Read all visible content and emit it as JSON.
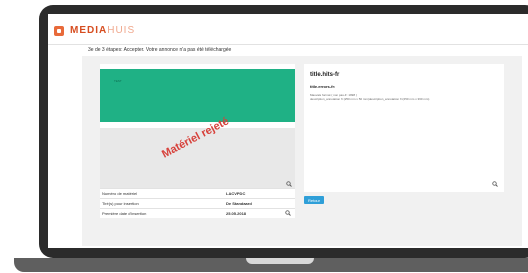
{
  "header": {
    "logo_bold": "MEDIA",
    "logo_light": "HUIS"
  },
  "step_text": "3e de 3 étapes: Accepter. Votre annonce n'a pas été téléchargée",
  "preview": {
    "green_label": "TEST",
    "stamp": "Matériel rejeté",
    "accent_color": "#1fb185",
    "stamp_color": "#d7403a"
  },
  "details": [
    {
      "label": "Numéro de matériel",
      "value": "LACVPDC"
    },
    {
      "label": "Tiré(s) pour insertion",
      "value": "De Standaard"
    },
    {
      "label": "Première date d'insertion",
      "value": "25.05.2018"
    }
  ],
  "right_panel": {
    "title": "title.hits-fr",
    "subtitle": "title.errors-fr:",
    "lines": [
      "Mauvais format ( non pas-fr: 1998 )",
      "description_annotation fr:(250 mm x 50 mm)description_annotation fr:(250 mm x 360 mm)"
    ]
  },
  "buttons": {
    "retour": "Retour"
  },
  "icons": {
    "zoom": "magnifier-icon"
  }
}
